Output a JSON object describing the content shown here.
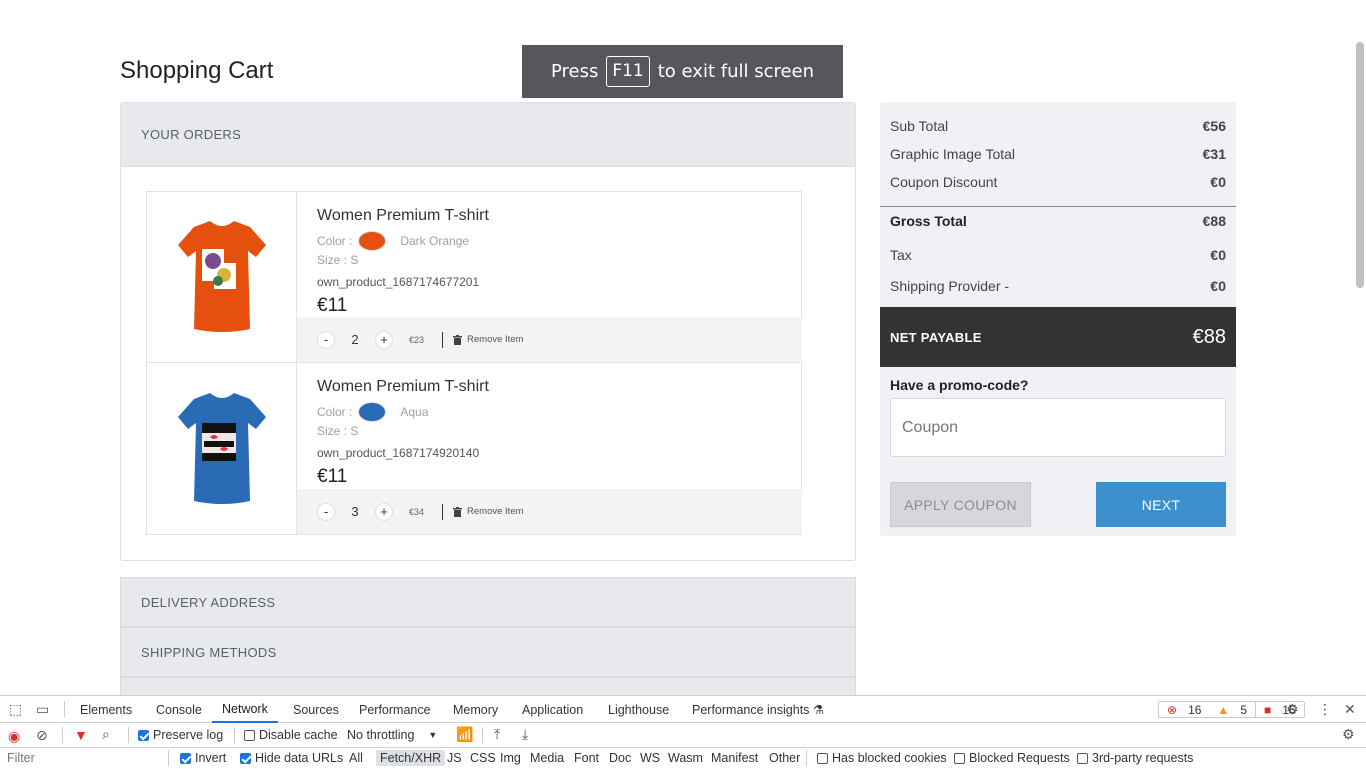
{
  "page": {
    "title": "Shopping Cart",
    "fullscreen_banner": {
      "prefix": "Press",
      "key": "F11",
      "suffix": "to exit full screen"
    }
  },
  "orders": {
    "header": "YOUR ORDERS",
    "items": [
      {
        "name": "Women Premium T-shirt",
        "color_label": "Color :",
        "color_name": "Dark Orange",
        "color_hex": "#e6500f",
        "size": "Size : S",
        "sku": "own_product_1687174677201",
        "price": "€11",
        "qty": "2",
        "line_total": "€23",
        "remove_label": "Remove Item",
        "minus": "-",
        "plus": "+"
      },
      {
        "name": "Women Premium T-shirt",
        "color_label": "Color :",
        "color_name": "Aqua",
        "color_hex": "#2a6bb5",
        "size": "Size : S",
        "sku": "own_product_1687174920140",
        "price": "€11",
        "qty": "3",
        "line_total": "€34",
        "remove_label": "Remove Item",
        "minus": "-",
        "plus": "+"
      }
    ]
  },
  "sections": {
    "delivery": "DELIVERY ADDRESS",
    "shipping": "SHIPPING METHODS"
  },
  "summary": {
    "sub_total_label": "Sub Total",
    "sub_total": "€56",
    "graphic_label": "Graphic Image Total",
    "graphic": "€31",
    "coupon_discount_label": "Coupon Discount",
    "coupon_discount": "€0",
    "gross_label": "Gross Total",
    "gross": "€88",
    "tax_label": "Tax",
    "tax": "€0",
    "shipping_label": "Shipping Provider -",
    "shipping": "€0",
    "net_label": "NET PAYABLE",
    "net": "€88",
    "promo_label": "Have a promo-code?",
    "coupon_placeholder": "Coupon",
    "apply_label": "APPLY COUPON",
    "next_label": "NEXT"
  },
  "devtools": {
    "tabs": [
      "Elements",
      "Console",
      "Network",
      "Sources",
      "Performance",
      "Memory",
      "Application",
      "Lighthouse",
      "Performance insights"
    ],
    "active_tab": "Network",
    "errors": "16",
    "warnings": "5",
    "issues": "16",
    "preserve_log": "Preserve log",
    "disable_cache": "Disable cache",
    "throttling": "No throttling",
    "filter_placeholder": "Filter",
    "invert": "Invert",
    "hide_data_urls": "Hide data URLs",
    "types": [
      "All",
      "Fetch/XHR",
      "JS",
      "CSS",
      "Img",
      "Media",
      "Font",
      "Doc",
      "WS",
      "Wasm",
      "Manifest",
      "Other"
    ],
    "has_blocked_cookies": "Has blocked cookies",
    "blocked_requests": "Blocked Requests",
    "third_party": "3rd-party requests"
  }
}
